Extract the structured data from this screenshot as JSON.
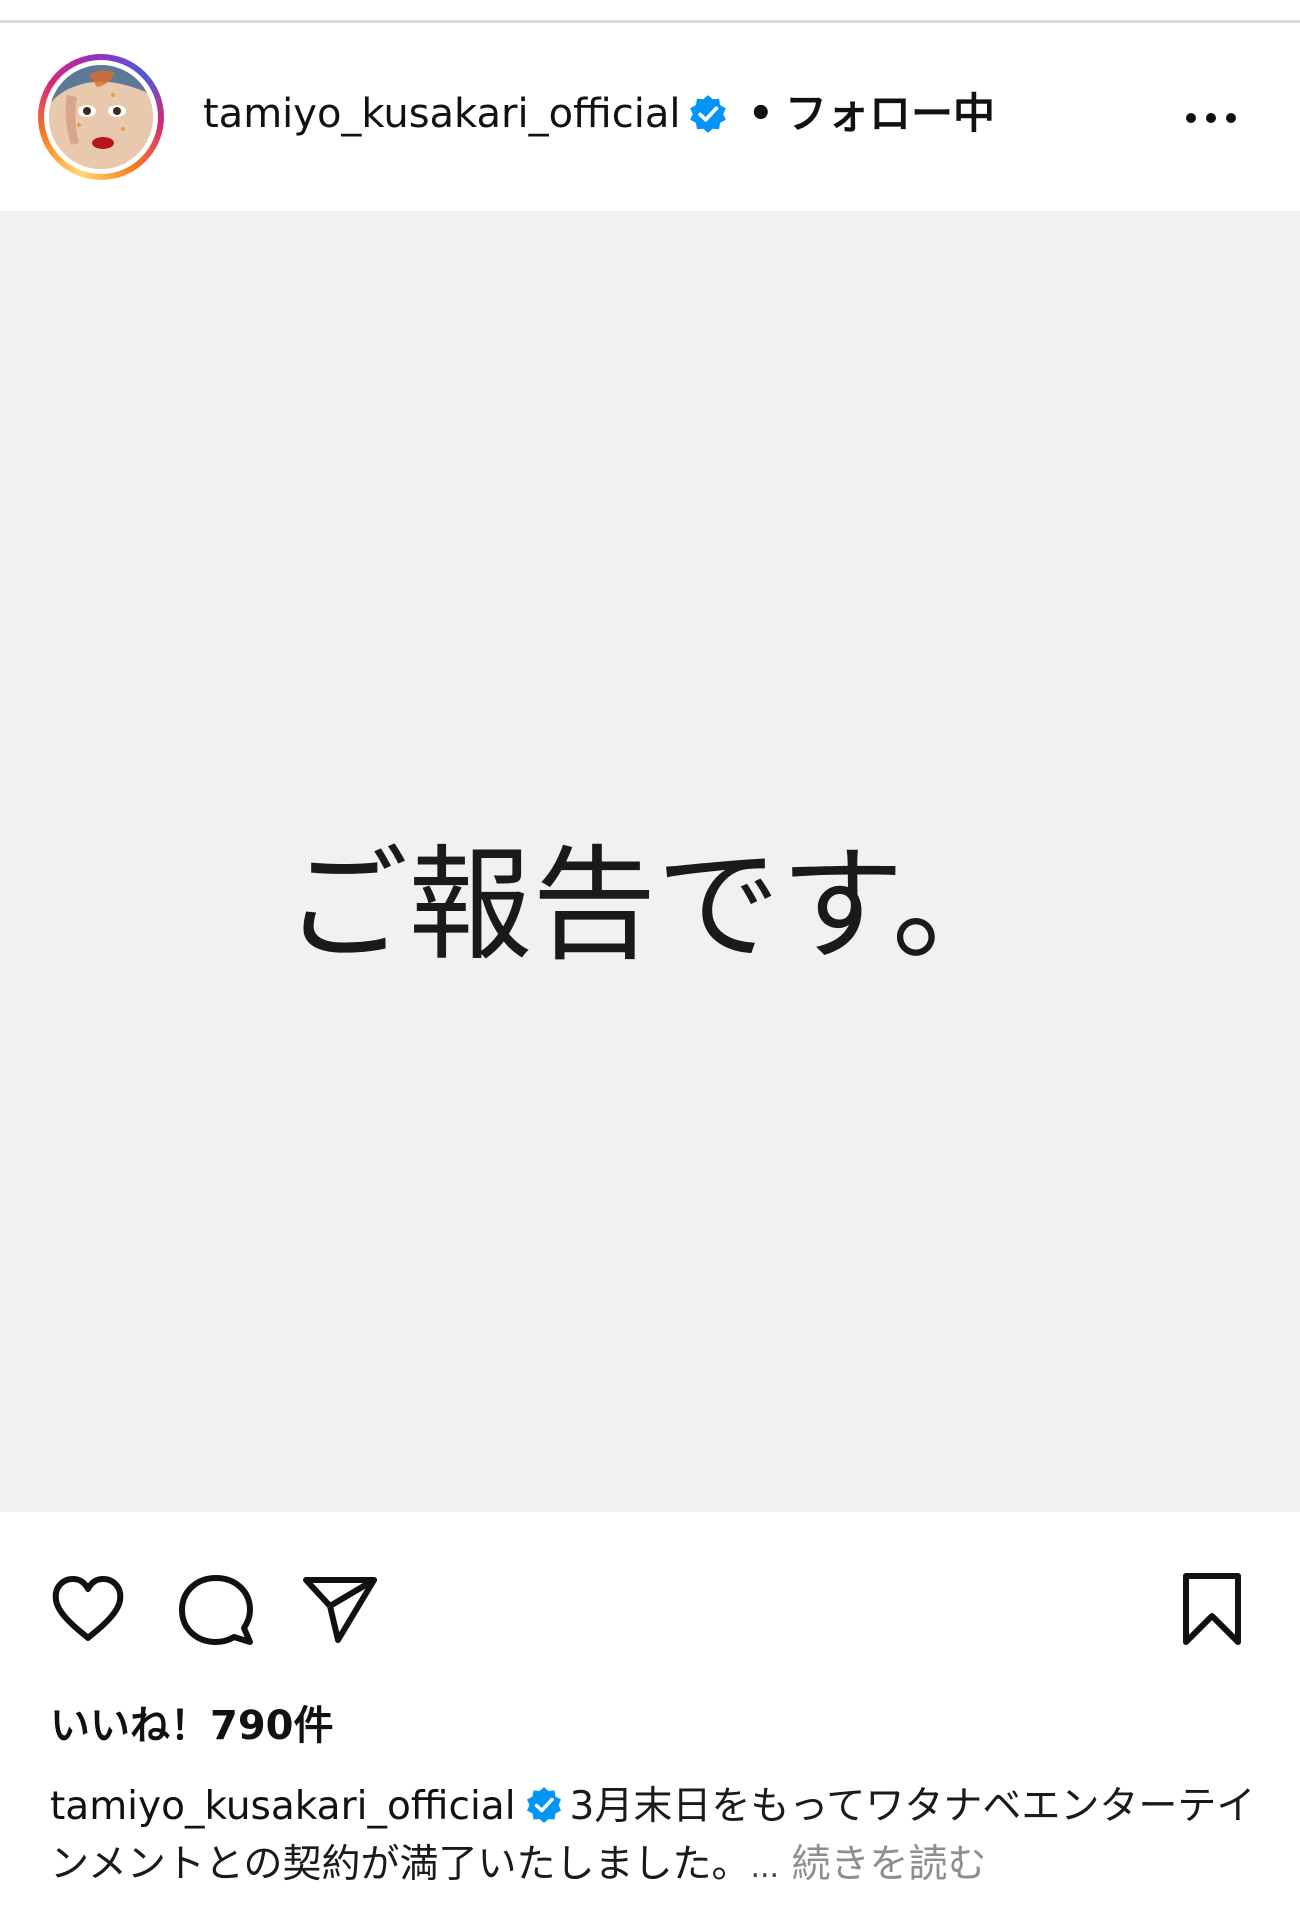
{
  "post": {
    "username": "tamiyo_kusakari_official",
    "separator": "•",
    "follow_status": "フォロー中",
    "image_text": "ご報告です。",
    "likes": "いいね！790件",
    "caption_username": "tamiyo_kusakari_official",
    "caption_text": "3月末日をもってワタナベエンターテインメントとの契約が満了いたしました。",
    "caption_ellipsis": "...",
    "read_more": "続きを読む"
  },
  "icons": {
    "avatar": "profile-avatar",
    "verified": "verified-badge-icon",
    "more": "more-options-icon",
    "like": "heart-icon",
    "comment": "comment-icon",
    "share": "paper-plane-icon",
    "save": "bookmark-icon"
  },
  "colors": {
    "verified_blue": "#0095f6",
    "image_background": "#f1f1f1",
    "muted_text": "#8e8e8e"
  }
}
